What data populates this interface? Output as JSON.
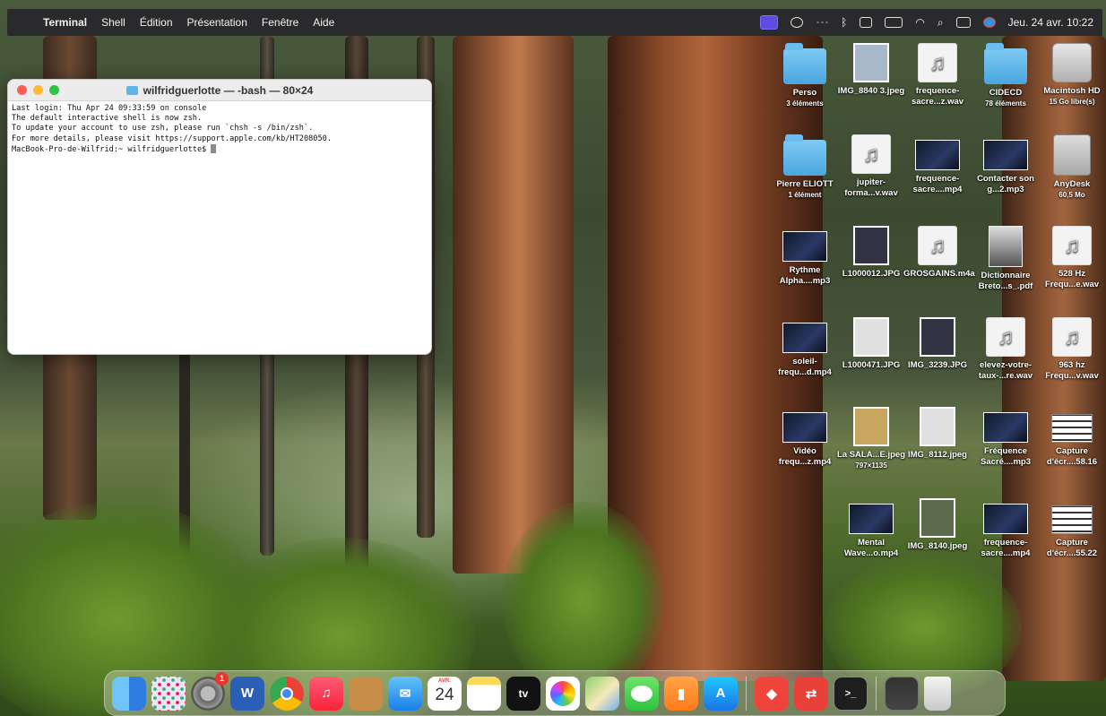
{
  "menubar": {
    "app_name": "Terminal",
    "items": [
      "Shell",
      "Édition",
      "Présentation",
      "Fenêtre",
      "Aide"
    ],
    "clock": "Jeu. 24 avr.  10:22"
  },
  "terminal": {
    "title": "wilfridguerlotte — -bash — 80×24",
    "lines": [
      "Last login: Thu Apr 24 09:33:59 on console",
      "",
      "The default interactive shell is now zsh.",
      "To update your account to use zsh, please run `chsh -s /bin/zsh`.",
      "For more details, please visit https://support.apple.com/kb/HT208050."
    ],
    "prompt": "MacBook-Pro-de-Wilfrid:~ wilfridguerlotte$ "
  },
  "desktop": {
    "icons": [
      {
        "label": "Perso",
        "sub": "3 éléments",
        "icon": "folder-icon"
      },
      {
        "label": "IMG_8840 3.jpeg",
        "sub": "",
        "icon": "photo-icon"
      },
      {
        "label": "frequence-sacre...z.wav",
        "sub": "",
        "icon": "audio-file-icon"
      },
      {
        "label": "CIDECD",
        "sub": "78 éléments",
        "icon": "folder-icon"
      },
      {
        "label": "Macintosh HD",
        "sub": "15 Go libre(s)",
        "icon": "hard-disk-icon"
      },
      {
        "label": "Pierre ELIOTT",
        "sub": "1 élément",
        "icon": "folder-icon"
      },
      {
        "label": "jupiter-forma...v.wav",
        "sub": "",
        "icon": "audio-file-icon"
      },
      {
        "label": "frequence-sacre....mp4",
        "sub": "",
        "icon": "video-file-icon"
      },
      {
        "label": "Contacter son g...2.mp3",
        "sub": "",
        "icon": "video-file-icon"
      },
      {
        "label": "AnyDesk",
        "sub": "60,5 Mo",
        "icon": "disk-image-icon"
      },
      {
        "label": "Rythme Alpha....mp3",
        "sub": "",
        "icon": "video-file-icon"
      },
      {
        "label": "L1000012.JPG",
        "sub": "",
        "icon": "photo-icon"
      },
      {
        "label": "GROSGAINS.m4a",
        "sub": "",
        "icon": "audio-file-icon"
      },
      {
        "label": "Dictionnaire Breto...s_.pdf",
        "sub": "",
        "icon": "pdf-file-icon"
      },
      {
        "label": "528 Hz Frequ...e.wav",
        "sub": "",
        "icon": "audio-file-icon"
      },
      {
        "label": "soleil-frequ...d.mp4",
        "sub": "",
        "icon": "video-file-icon"
      },
      {
        "label": "L1000471.JPG",
        "sub": "",
        "icon": "photo-icon"
      },
      {
        "label": "IMG_3239.JPG",
        "sub": "",
        "icon": "photo-icon"
      },
      {
        "label": "elevez-votre-taux-...re.wav",
        "sub": "",
        "icon": "audio-file-icon"
      },
      {
        "label": "963 hz Frequ...v.wav",
        "sub": "",
        "icon": "audio-file-icon"
      },
      {
        "label": "Vidéo frequ...z.mp4",
        "sub": "",
        "icon": "video-file-icon"
      },
      {
        "label": "La SALA...E.jpeg",
        "sub": "797×1135",
        "icon": "photo-icon"
      },
      {
        "label": "IMG_8112.jpeg",
        "sub": "",
        "icon": "photo-icon"
      },
      {
        "label": "Fréquence Sacré....mp3",
        "sub": "",
        "icon": "video-file-icon"
      },
      {
        "label": "Capture d'écr....58.16",
        "sub": "",
        "icon": "screenshot-icon"
      },
      {
        "label": "Mental Wave...o.mp4",
        "sub": "",
        "icon": "video-file-icon"
      },
      {
        "label": "IMG_8140.jpeg",
        "sub": "",
        "icon": "photo-icon"
      },
      {
        "label": "frequence-sacre....mp4",
        "sub": "",
        "icon": "video-file-icon"
      },
      {
        "label": "Capture d'écr....55.22",
        "sub": "",
        "icon": "screenshot-icon"
      }
    ]
  },
  "dock": {
    "system_settings_badge": "1",
    "calendar_month": "AVR.",
    "calendar_day": "24",
    "tv_label": "tv",
    "apps": [
      "finder-icon",
      "launchpad-icon",
      "system-settings-icon",
      "word-icon",
      "chrome-icon",
      "music-icon",
      "contacts-icon",
      "mail-icon",
      "calendar-icon",
      "notes-icon",
      "apple-tv-icon",
      "photos-icon",
      "maps-icon",
      "messages-icon",
      "books-icon",
      "app-store-icon",
      "anydesk-icon",
      "teamviewer-icon",
      "terminal-icon",
      "recent-document-icon",
      "trash-icon"
    ]
  },
  "colors": {
    "menubar_bg": "#2a2a2c",
    "active_status_icon": "#5a4de0",
    "traffic_red": "#fe5f57",
    "traffic_yellow": "#febc2e",
    "traffic_green": "#28c840"
  }
}
